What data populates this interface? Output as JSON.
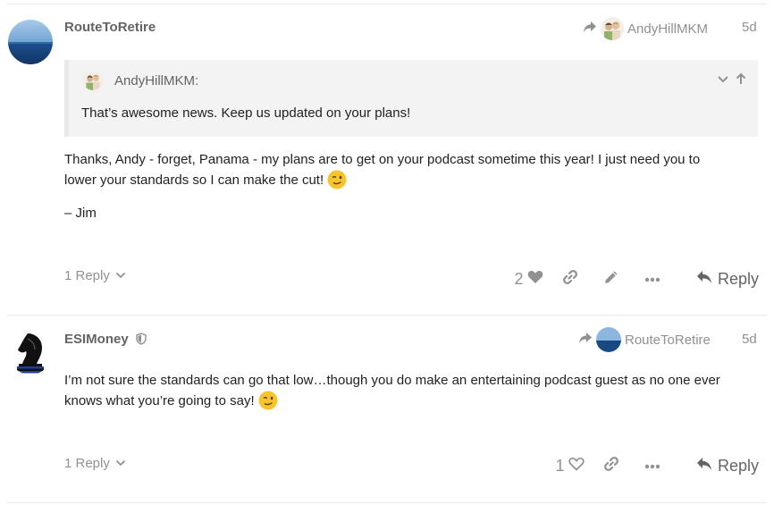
{
  "post1": {
    "username": "RouteToRetire",
    "reply_to_user": "AndyHillMKM",
    "date": "5d",
    "quote": {
      "author": "AndyHillMKM:",
      "text": "That’s awesome news. Keep us updated on your plans!"
    },
    "body_line1": "Thanks, Andy - forget, Panama - my plans are to get on your podcast sometime this year! I just need you to",
    "body_line2": "lower your standards so I can make the cut!",
    "signature": "– Jim",
    "replies_label": "1 Reply",
    "like_count": "2",
    "reply_label": "Reply"
  },
  "post2": {
    "username": "ESIMoney",
    "reply_to_user": "RouteToRetire",
    "date": "5d",
    "body_line1": "I’m not sure the standards can go that low…though you do make an entertaining podcast guest as no one ever",
    "body_line2": "knows what you’re going to say!",
    "replies_label": "1 Reply",
    "like_count": "1",
    "reply_label": "Reply"
  },
  "icons": {
    "reply_arrow": "share-arrow-icon",
    "heart": "heart-icon",
    "link": "link-icon",
    "edit": "pencil-icon",
    "more": "ellipsis-icon",
    "chevron": "chevron-down-icon",
    "moderator": "shield-icon",
    "emoji": "winking-face-emoji"
  },
  "colors": {
    "muted_text": "#919191",
    "username": "#646464",
    "quote_bg": "#f3f3f3",
    "emoji_yellow": "#f7c52b"
  }
}
